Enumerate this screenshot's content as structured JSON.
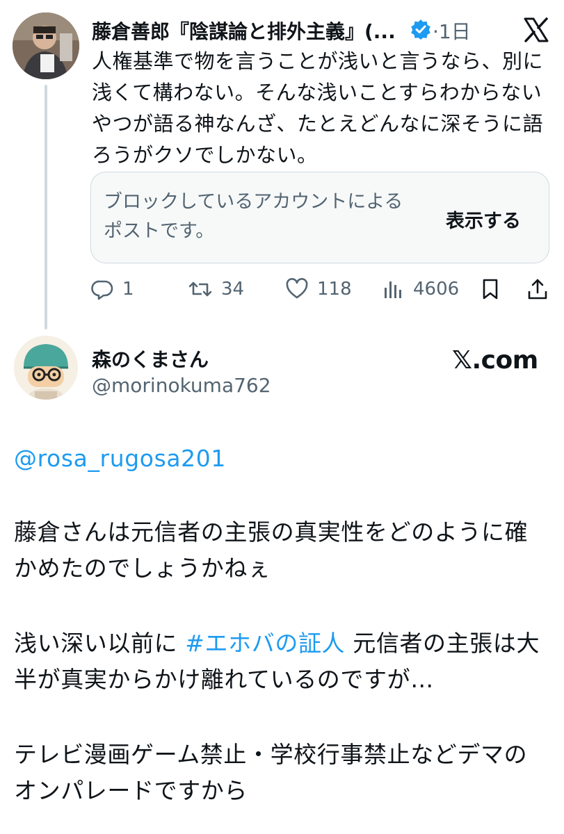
{
  "tweet1": {
    "author": "藤倉善郎『陰謀論と排外主義』(...",
    "time": "·1日",
    "text": "人権基準で物を言うことが浅いと言うなら、別に浅くて構わない。そんな浅いことすらわからないやつが語る神なんざ、たとえどんなに深そうに語ろうがクソでしかない。",
    "quote": {
      "text": "ブロックしているアカウントによるポストです。",
      "show_label": "表示する"
    },
    "actions": {
      "replies": "1",
      "reposts": "34",
      "likes": "118",
      "views": "4606"
    }
  },
  "tweet2": {
    "name": "森のくまさん",
    "handle": "@morinokuma762",
    "brand": "𝕏.com",
    "mention": "@rosa_rugosa201",
    "para1": "藤倉さんは元信者の主張の真実性をどのように確かめたのでしょうかねぇ",
    "para2_before": "浅い深い以前に ",
    "para2_hashtag": "#エホバの証人",
    "para2_after": " 元信者の主張は大半が真実からかけ離れているのですが…",
    "para3": "テレビ漫画ゲーム禁止・学校行事禁止などデマのオンパレードですから"
  },
  "colors": {
    "link": "#1d9bf0",
    "verified": "#1d9bf0",
    "secondary_text": "#536471"
  },
  "icons": [
    "verified-badge-icon",
    "x-logo-icon",
    "reply-icon",
    "repost-icon",
    "like-icon",
    "views-icon",
    "bookmark-icon",
    "share-icon"
  ]
}
